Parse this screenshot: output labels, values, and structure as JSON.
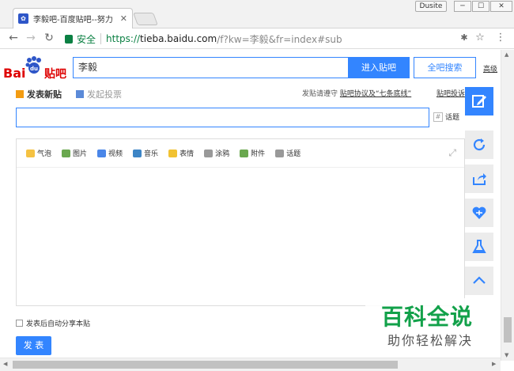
{
  "browser": {
    "tab_title": "李毅吧-百度贴吧--努力",
    "user_badge": "Dusite",
    "security_label": "安全",
    "url_scheme": "https://",
    "url_host": "tieba.baidu.com",
    "url_rest": "/f?kw=李毅&fr=index#sub"
  },
  "header": {
    "logo_text_1": "Bai",
    "logo_text_2": "贴吧",
    "search_value": "李毅",
    "enter_button": "进入贴吧",
    "search_button": "全吧搜索",
    "advanced_link": "高级"
  },
  "post": {
    "new_post_tab": "发表新贴",
    "vote_tab": "发起投票",
    "rules_prefix": "发贴请遵守",
    "rules_link": "贴吧协议及“七条底线”",
    "rules_link_2": "贴吧投诉",
    "topic_button": "话题",
    "tools": [
      {
        "label": "气泡",
        "color": "#f5c242"
      },
      {
        "label": "图片",
        "color": "#6aa84f"
      },
      {
        "label": "视频",
        "color": "#4a86e8"
      },
      {
        "label": "音乐",
        "color": "#3d85c6"
      },
      {
        "label": "表情",
        "color": "#f1c232"
      },
      {
        "label": "涂鸦",
        "color": "#999999"
      },
      {
        "label": "附件",
        "color": "#6aa84f"
      },
      {
        "label": "话题",
        "color": "#999999"
      }
    ],
    "share_label": "发表后自动分享本贴",
    "submit_button": "发 表"
  },
  "watermark": {
    "line1": "百科全说",
    "line2": "助你轻松解决"
  },
  "colors": {
    "accent": "#3385ff",
    "brand_red": "#de0000",
    "secure_green": "#0b8043",
    "watermark_green": "#12a14a"
  }
}
